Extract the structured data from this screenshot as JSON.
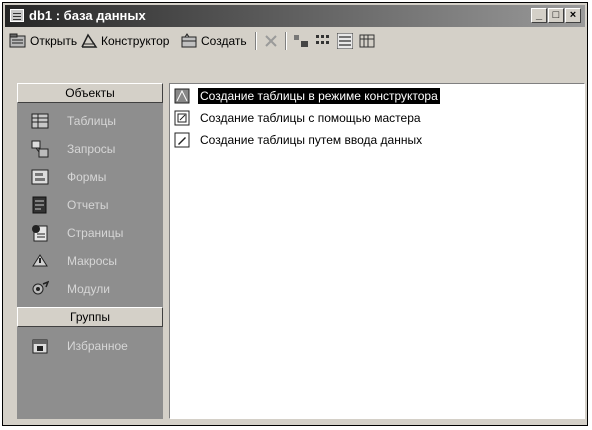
{
  "window": {
    "title": "db1 : база данных"
  },
  "title_buttons": [
    "_",
    "□",
    "×"
  ],
  "toolbar": {
    "open_label": "Открыть",
    "design_label": "Конструктор",
    "create_label": "Создать"
  },
  "sidebar": {
    "objects_header": "Объекты",
    "items": [
      {
        "label": "Таблицы",
        "icon": "table-icon"
      },
      {
        "label": "Запросы",
        "icon": "query-icon"
      },
      {
        "label": "Формы",
        "icon": "form-icon"
      },
      {
        "label": "Отчеты",
        "icon": "report-icon"
      },
      {
        "label": "Страницы",
        "icon": "page-icon"
      },
      {
        "label": "Макросы",
        "icon": "macro-icon"
      },
      {
        "label": "Модули",
        "icon": "module-icon"
      }
    ],
    "groups_header": "Группы",
    "group_items": [
      {
        "label": "Избранное",
        "icon": "favorites-icon"
      }
    ]
  },
  "content": {
    "items": [
      {
        "label": "Создание таблицы в режиме конструктора",
        "selected": true
      },
      {
        "label": "Создание таблицы с помощью мастера",
        "selected": false
      },
      {
        "label": "Создание таблицы путем ввода данных",
        "selected": false
      }
    ]
  }
}
